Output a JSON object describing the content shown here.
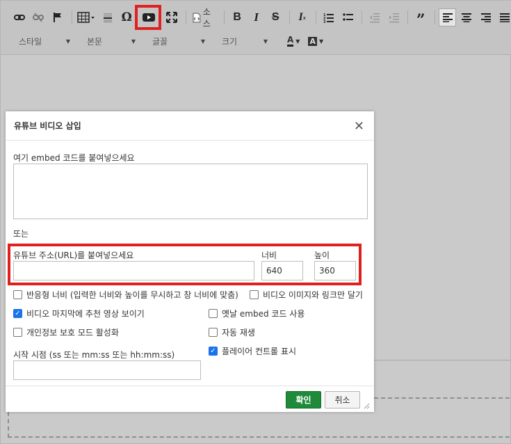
{
  "toolbar": {
    "source_label": "소스",
    "style_combo": "스타일",
    "format_combo": "본문",
    "font_combo": "글꼴",
    "size_combo": "크기",
    "text_color_label": "A",
    "bg_color_label": "A",
    "icons": [
      "link-icon",
      "unlink-icon",
      "anchor-flag-icon",
      "table-icon",
      "horizontal-rule-icon",
      "special-char-icon",
      "youtube-icon",
      "maximize-icon",
      "source-icon",
      "bold-icon",
      "italic-icon",
      "strikethrough-icon",
      "remove-format-icon",
      "numbered-list-icon",
      "bulleted-list-icon",
      "outdent-icon",
      "indent-icon",
      "blockquote-icon",
      "align-left-icon",
      "align-center-icon",
      "align-right-icon",
      "justify-icon"
    ]
  },
  "dialog": {
    "title": "유튜브 비디오 삽입",
    "embed_label": "여기 embed 코드를 붙여넣으세요",
    "embed_value": "",
    "or_label": "또는",
    "url_label": "유튜브 주소(URL)를 붙여넣으세요",
    "url_value": "",
    "width_label": "너비",
    "width_value": "640",
    "height_label": "높이",
    "height_value": "360",
    "options": {
      "responsive": {
        "label": "반응형 너비 (입력한 너비와 높이를 무시하고 창 너비에 맞춤)",
        "checked": false
      },
      "image_link_only": {
        "label": "비디오 이미지와 링크만 달기",
        "checked": false
      },
      "show_related": {
        "label": "비디오 마지막에 추천 영상 보이기",
        "checked": true
      },
      "old_embed": {
        "label": "옛날 embed 코드 사용",
        "checked": false
      },
      "privacy_mode": {
        "label": "개인정보 보호 모드 활성화",
        "checked": false
      },
      "autoplay": {
        "label": "자동 재생",
        "checked": false
      },
      "show_controls": {
        "label": "플레이어 컨트롤 표시",
        "checked": true
      }
    },
    "start_label": "시작 시점 (ss 또는 mm:ss 또는 hh:mm:ss)",
    "start_value": "",
    "ok_label": "확인",
    "cancel_label": "취소"
  },
  "colors": {
    "highlight": "#e0201f",
    "ok_button": "#1f8a3a",
    "checkbox_on": "#1a73e8"
  }
}
